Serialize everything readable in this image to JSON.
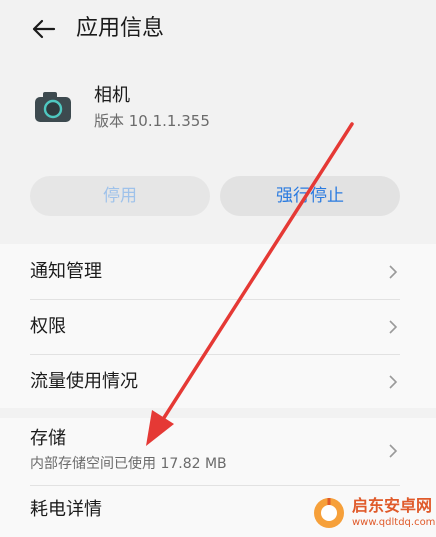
{
  "header": {
    "title": "应用信息"
  },
  "app": {
    "name": "相机",
    "version": "版本 10.1.1.355"
  },
  "actions": {
    "disable_label": "停用",
    "force_stop_label": "强行停止"
  },
  "rows": [
    {
      "label": "通知管理"
    },
    {
      "label": "权限"
    },
    {
      "label": "流量使用情况"
    },
    {
      "label": "存储",
      "sub": "内部存储空间已使用 17.82 MB"
    },
    {
      "label": "耗电详情"
    }
  ],
  "watermark": {
    "title": "启东安卓网",
    "url": "www.qdltdq.com"
  },
  "colors": {
    "accent": "#2a7be0",
    "arrow": "#e53935",
    "disabled_text": "#9fc2ea"
  }
}
